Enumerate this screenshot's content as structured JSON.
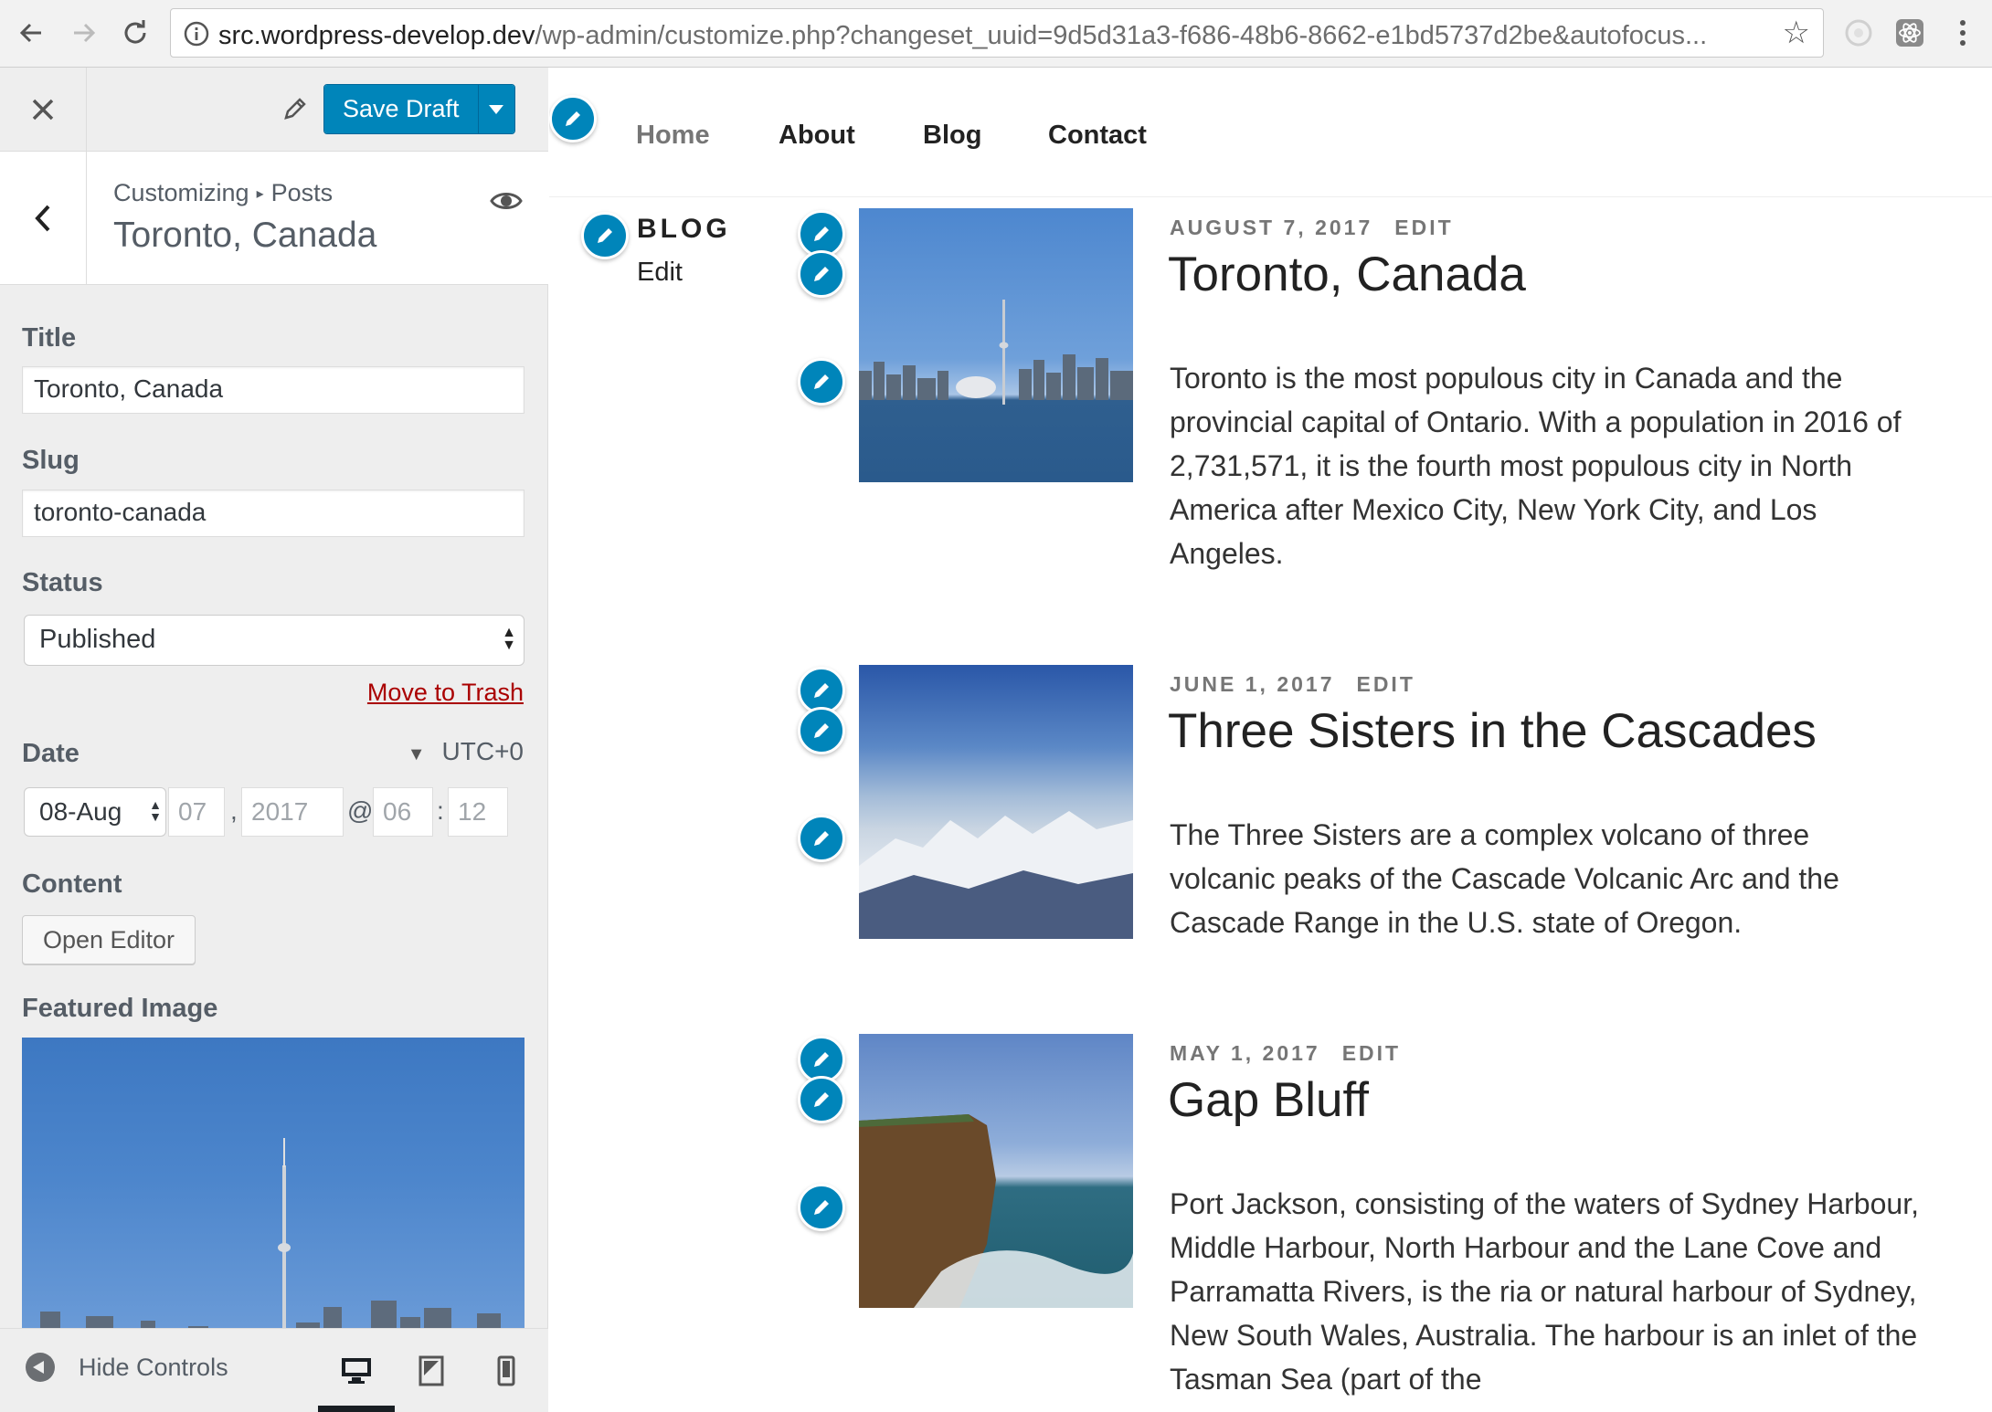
{
  "browser": {
    "url_host": "src.wordpress-develop.dev",
    "url_rest": "/wp-admin/customize.php?changeset_uuid=9d5d31a3-f686-48b6-8662-e1bd5737d2be&autofocus..."
  },
  "customizer": {
    "save_label": "Save Draft",
    "breadcrumb_root": "Customizing",
    "breadcrumb_section": "Posts",
    "section_title": "Toronto, Canada",
    "fields": {
      "title_label": "Title",
      "title_value": "Toronto, Canada",
      "slug_label": "Slug",
      "slug_value": "toronto-canada",
      "status_label": "Status",
      "status_value": "Published",
      "trash_label": "Move to Trash",
      "date_label": "Date",
      "timezone": "UTC+0",
      "date_month": "08-Aug",
      "date_day": "07",
      "date_year": "2017",
      "date_hour": "06",
      "date_minute": "12",
      "at_sign": "@",
      "comma": ",",
      "colon": ":",
      "content_label": "Content",
      "open_editor": "Open Editor",
      "featured_label": "Featured Image"
    },
    "footer": {
      "hide_controls": "Hide Controls"
    }
  },
  "site": {
    "nav": [
      "Home",
      "About",
      "Blog",
      "Contact"
    ],
    "widget_title": "BLOG",
    "widget_edit": "Edit",
    "posts": [
      {
        "date": "AUGUST 7, 2017",
        "edit": "EDIT",
        "title": "Toronto, Canada",
        "excerpt": "Toronto is the most populous city in Canada and the provincial capital of Ontario. With a population in 2016 of 2,731,571, it is the fourth most populous city in North America after Mexico City, New York City, and Los Angeles."
      },
      {
        "date": "JUNE 1, 2017",
        "edit": "EDIT",
        "title": "Three Sisters in the Cascades",
        "excerpt": "The Three Sisters are a complex volcano of three volcanic peaks of the Cascade Volcanic Arc and the Cascade Range in the U.S. state of Oregon."
      },
      {
        "date": "MAY 1, 2017",
        "edit": "EDIT",
        "title": "Gap Bluff",
        "excerpt": "Port Jackson, consisting of the waters of Sydney Harbour, Middle Harbour, North Harbour and the Lane Cove and Parramatta Rivers, is the ria or natural harbour of Sydney, New South Wales, Australia. The harbour is an inlet of the Tasman Sea (part of the"
      }
    ]
  },
  "colors": {
    "accent": "#0085ba",
    "trash": "#aa0000",
    "sidebar_bg": "#eeeeee"
  }
}
